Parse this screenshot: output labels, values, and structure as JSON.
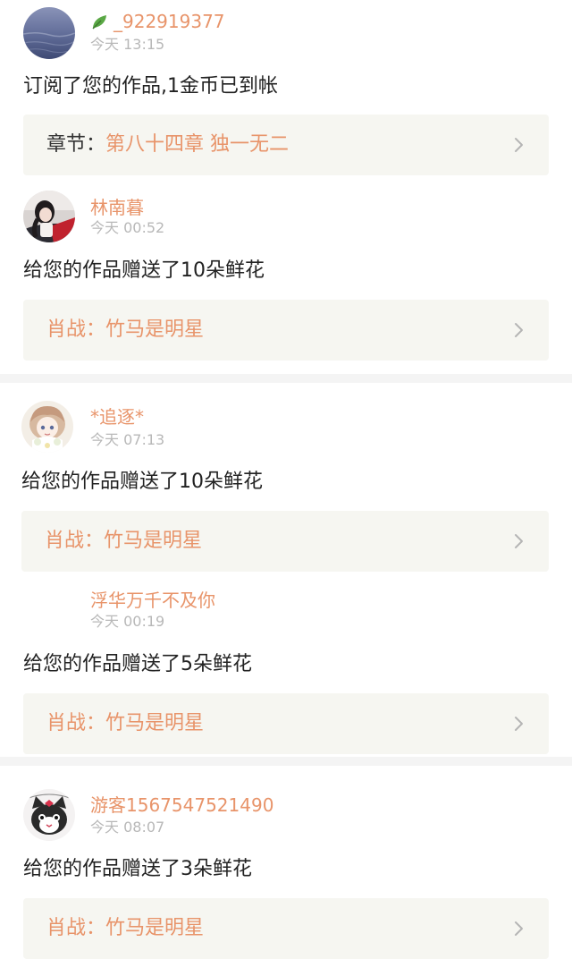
{
  "accent_color": "#e8946a",
  "notifications": [
    {
      "username": "_922919377",
      "username_icon": "leaf-icon",
      "time": "今天 13:15",
      "message": "订阅了您的作品,1金币已到帐",
      "card": {
        "prefix": "章节：",
        "title": "第八十四章 独一无二"
      }
    },
    {
      "username": "林南暮",
      "time": "今天 00:52",
      "message": "给您的作品赠送了10朵鲜花",
      "card": {
        "prefix": "",
        "title": "肖战：竹马是明星"
      }
    },
    {
      "username": "*追逐*",
      "time": "今天 07:13",
      "message": "给您的作品赠送了10朵鲜花",
      "card": {
        "prefix": "",
        "title": "肖战：竹马是明星"
      }
    },
    {
      "username": "浮华万千不及你",
      "time": "今天 00:19",
      "message": "给您的作品赠送了5朵鲜花",
      "card": {
        "prefix": "",
        "title": "肖战：竹马是明星"
      }
    },
    {
      "username": "游客1567547521490",
      "time": "今天 08:07",
      "message": "给您的作品赠送了3朵鲜花",
      "card": {
        "prefix": "",
        "title": "肖战：竹马是明星"
      }
    }
  ]
}
